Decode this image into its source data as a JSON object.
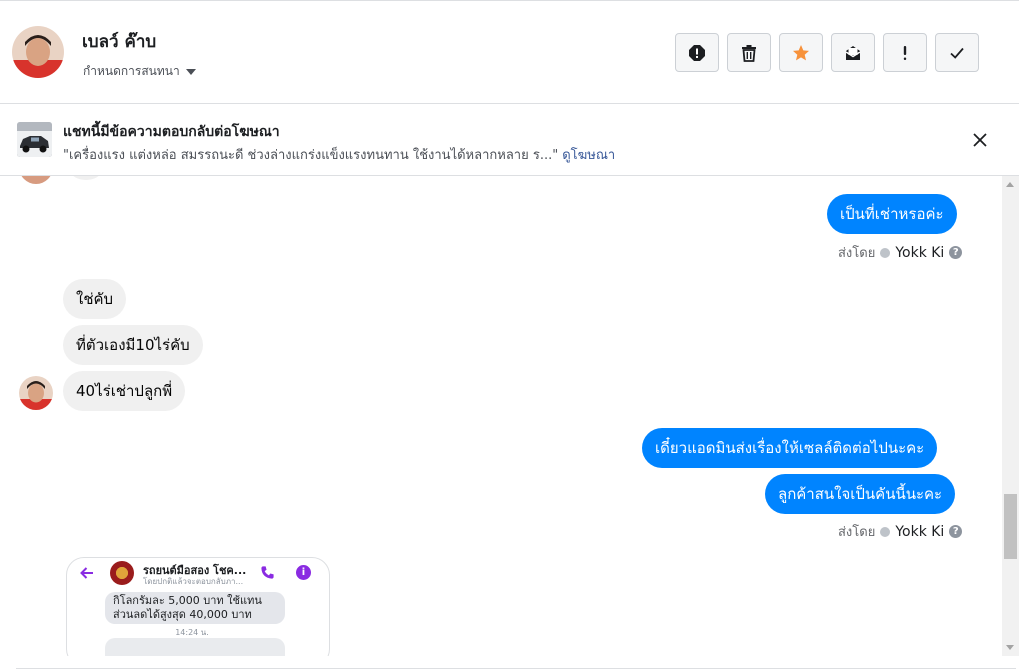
{
  "header": {
    "name": "เบลว์ ค๊าบ",
    "labels_dropdown": "กำหนดการสนทนา",
    "actions": [
      {
        "name": "mark-spam-button",
        "icon": "stop-alert-icon"
      },
      {
        "name": "delete-button",
        "icon": "trash-icon"
      },
      {
        "name": "star-button",
        "icon": "star-icon",
        "color": "#f7923b"
      },
      {
        "name": "mark-unread-button",
        "icon": "envelope-icon"
      },
      {
        "name": "follow-up-button",
        "icon": "exclamation-icon"
      },
      {
        "name": "mark-done-button",
        "icon": "check-icon"
      }
    ]
  },
  "ad_banner": {
    "title": "แชทนี้มีข้อความตอบกลับต่อโฆษณา",
    "description": "\"เครื่องแรง แต่งหล่อ สมรรถนะดี ช่วงล่างแกร่งแข็งแรงทนทาน ใช้งานได้หลากหลาย ร...\"",
    "link": "ดูโฆษณา"
  },
  "messages": {
    "m1": "เป็นที่เช่าหรอค่ะ",
    "m2": "ใช่คับ",
    "m3": "ที่ตัวเองมี10ไร่คับ",
    "m4": "40ไร่เช่าปลูกพี่",
    "m5": "เดี๋ยวแอดมินส่งเรื่องให้เซลล์ติดต่อไปนะคะ",
    "m6": "ลูกค้าสนใจเป็นคันนี้นะคะ"
  },
  "sent_by": {
    "label": "ส่งโดย",
    "name": "Yokk Ki",
    "help": "?"
  },
  "attachment": {
    "page_name": "รถยนต์มือสอง โชค...",
    "subtitle": "โดยปกติแล้วจะตอบกลับภา...",
    "message": "กิโลกรัมละ 5,000 บาท ใช้แทน ส่วนลดได้สูงสุด 40,000 บาท",
    "time": "14:24 น.",
    "info_glyph": "i"
  },
  "colors": {
    "outgoing_bubble": "#0084ff",
    "incoming_bubble": "#f0f0f0",
    "link": "#385898"
  }
}
